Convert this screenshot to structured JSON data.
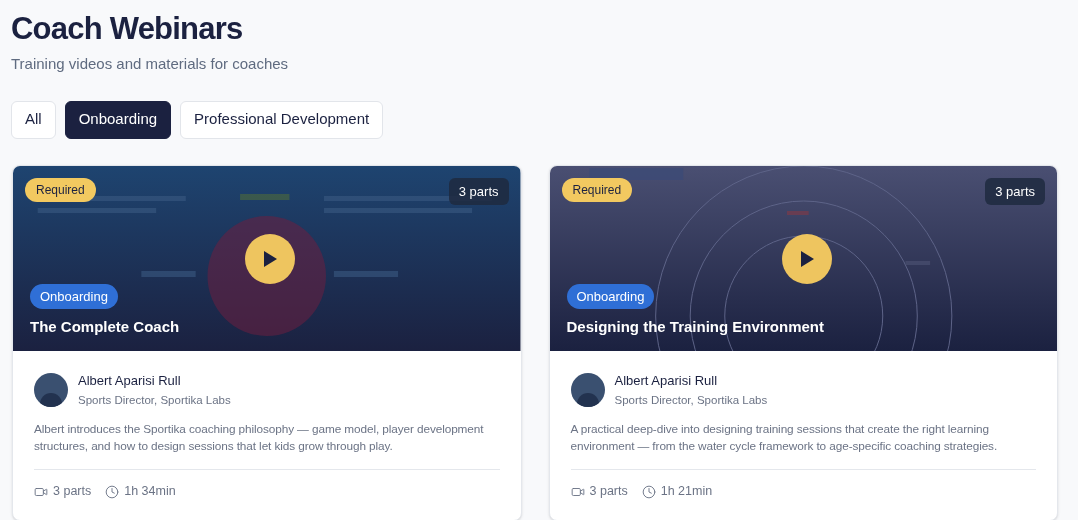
{
  "header": {
    "title": "Coach Webinars",
    "subtitle": "Training videos and materials for coaches"
  },
  "filters": [
    {
      "label": "All",
      "selected": false
    },
    {
      "label": "Onboarding",
      "selected": true
    },
    {
      "label": "Professional Development",
      "selected": false
    }
  ],
  "webinars": [
    {
      "required": "Required",
      "parts_badge": "3 parts",
      "category": "Onboarding",
      "title": "The Complete Coach",
      "presenter": "Albert Aparisi Rull",
      "role": "Sports Director, Sportika Labs",
      "description": "Albert introduces the Sportika coaching philosophy — game model, player development structures, and how to design sessions that let kids grow through play.",
      "parts": "3 parts",
      "duration": "1h 34min"
    },
    {
      "required": "Required",
      "parts_badge": "3 parts",
      "category": "Onboarding",
      "title": "Designing the Training Environment",
      "presenter": "Albert Aparisi Rull",
      "role": "Sports Director, Sportika Labs",
      "description": "A practical deep-dive into designing training sessions that create the right learning environment — from the water cycle framework to age-specific coaching strategies.",
      "parts": "3 parts",
      "duration": "1h 21min"
    }
  ]
}
